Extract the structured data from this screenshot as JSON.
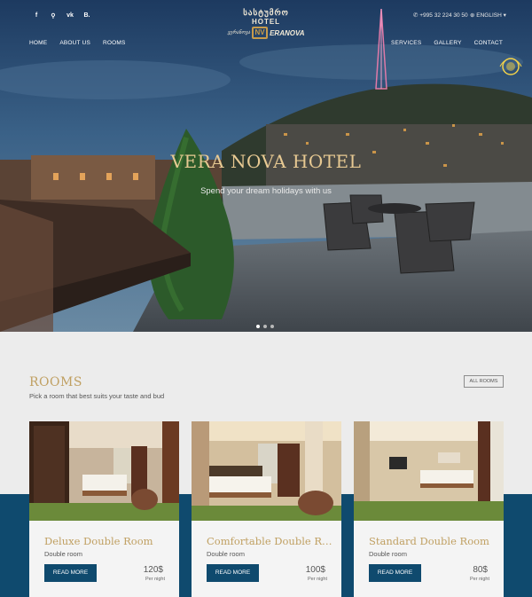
{
  "social": [
    "f",
    "⚲",
    "vk",
    "B."
  ],
  "contact": {
    "phone": "✆ +995 32 224 30 50",
    "language": "⊕ ENGLISH ▾"
  },
  "logo": {
    "georgian": "სასტუმრო",
    "hotel": "HOTEL",
    "small_left": "სასტუმრო",
    "small_right": "ვერანოვა",
    "brand": "ERANOVA",
    "mark": "NV"
  },
  "nav": {
    "left": [
      "HOME",
      "ABOUT US",
      "ROOMS"
    ],
    "right": [
      "SERVICES",
      "GALLERY",
      "CONTACT"
    ]
  },
  "hero": {
    "title": "VERA NOVA HOTEL",
    "subtitle": "Spend your dream holidays with us",
    "slides": 3,
    "active_slide": 0
  },
  "rooms": {
    "title": "ROOMS",
    "subtitle": "Pick a room that best suits your taste and bud",
    "all_button": "ALL ROOMS",
    "cards": [
      {
        "title": "Deluxe Double Room",
        "type": "Double room",
        "button": "READ MORE",
        "price": "120$",
        "per": "Per night"
      },
      {
        "title": "Comfortable Double Ro...",
        "type": "Double room",
        "button": "READ MORE",
        "price": "100$",
        "per": "Per night"
      },
      {
        "title": "Standard Double Room",
        "type": "Double room",
        "button": "READ MORE",
        "price": "80$",
        "per": "Per night"
      }
    ]
  },
  "colors": {
    "accent_gold": "#c0a062",
    "navy": "#0f4a6e",
    "background": "#ececec"
  }
}
